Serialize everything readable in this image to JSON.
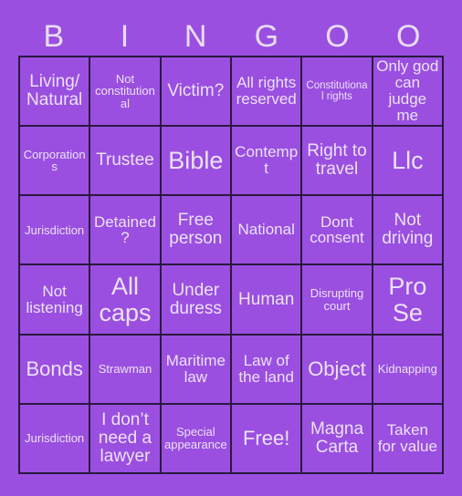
{
  "card": {
    "background_color": "#9a4fe0",
    "border_color": "#2b1840",
    "text_color": "#ece1f7",
    "columns": 6,
    "rows": 6
  },
  "header": {
    "letters": [
      "B",
      "I",
      "N",
      "G",
      "O",
      "O"
    ]
  },
  "grid": {
    "cells": [
      {
        "text": "Living/ Natural",
        "size": "l"
      },
      {
        "text": "Not constitutional",
        "size": "s"
      },
      {
        "text": "Victim?",
        "size": "l"
      },
      {
        "text": "All rights reserved",
        "size": "m"
      },
      {
        "text": "Constitutional rights",
        "size": "xs"
      },
      {
        "text": "Only god can judge me",
        "size": "m"
      },
      {
        "text": "Corporations",
        "size": "s"
      },
      {
        "text": "Trustee",
        "size": "l"
      },
      {
        "text": "Bible",
        "size": "xxl"
      },
      {
        "text": "Contempt",
        "size": "m"
      },
      {
        "text": "Right to travel",
        "size": "l"
      },
      {
        "text": "Llc",
        "size": "xxl"
      },
      {
        "text": "Jurisdiction",
        "size": "s"
      },
      {
        "text": "Detained?",
        "size": "m"
      },
      {
        "text": "Free person",
        "size": "l"
      },
      {
        "text": "National",
        "size": "m"
      },
      {
        "text": "Dont consent",
        "size": "m"
      },
      {
        "text": "Not driving",
        "size": "l"
      },
      {
        "text": "Not listening",
        "size": "m"
      },
      {
        "text": "All caps",
        "size": "xxl"
      },
      {
        "text": "Under duress",
        "size": "l"
      },
      {
        "text": "Human",
        "size": "l"
      },
      {
        "text": "Disrupting court",
        "size": "s"
      },
      {
        "text": "Pro Se",
        "size": "xxl"
      },
      {
        "text": "Bonds",
        "size": "xl"
      },
      {
        "text": "Strawman",
        "size": "s"
      },
      {
        "text": "Maritime law",
        "size": "m"
      },
      {
        "text": "Law of the land",
        "size": "m"
      },
      {
        "text": "Object",
        "size": "xl"
      },
      {
        "text": "Kidnapping",
        "size": "s"
      },
      {
        "text": "Jurisdiction",
        "size": "s"
      },
      {
        "text": "I don’t need a lawyer",
        "size": "l"
      },
      {
        "text": "Special appearance",
        "size": "s"
      },
      {
        "text": "Free!",
        "size": "xl"
      },
      {
        "text": "Magna Carta",
        "size": "l"
      },
      {
        "text": "Taken for value",
        "size": "m"
      }
    ]
  }
}
